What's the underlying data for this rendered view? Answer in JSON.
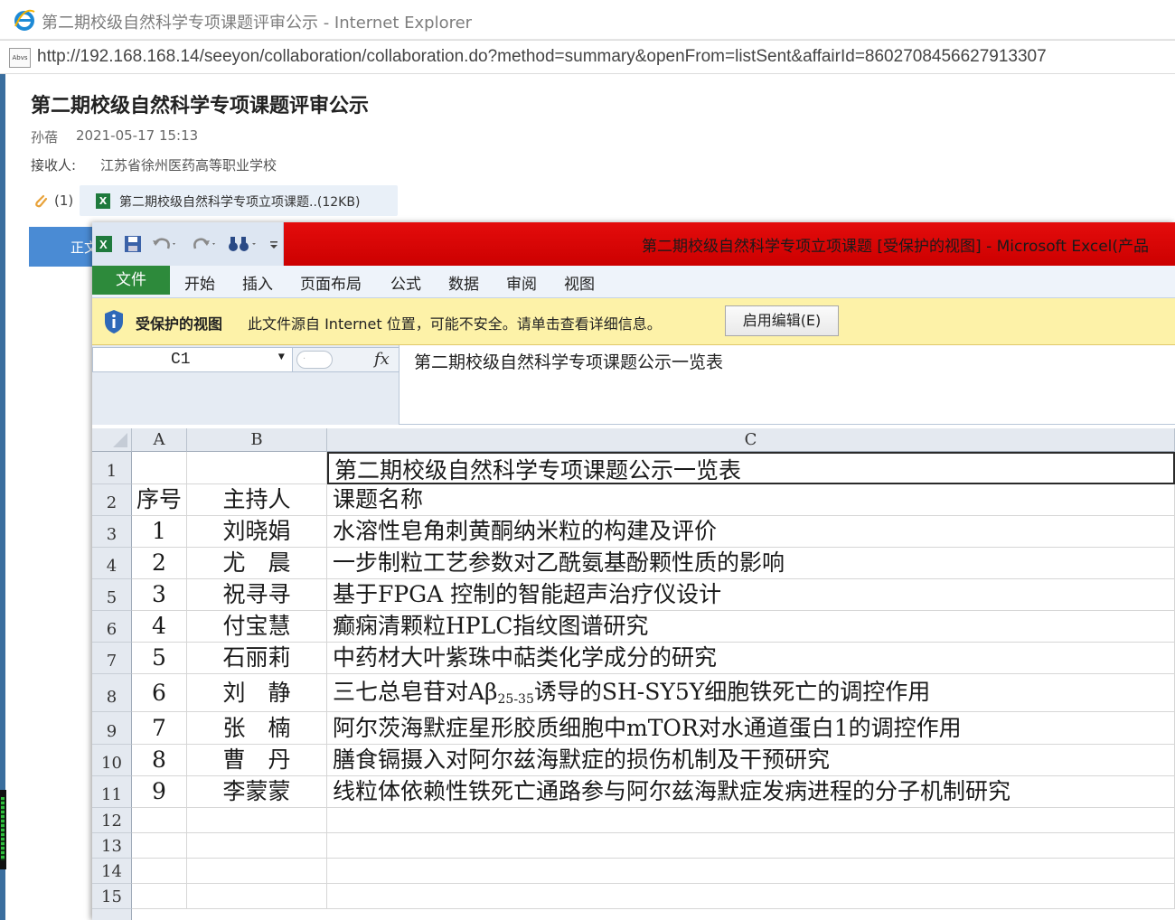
{
  "browser": {
    "window_title": "第二期校级自然科学专项课题评审公示 - Internet Explorer",
    "address_url": "http://192.168.168.14/seeyon/collaboration/collaboration.do?method=summary&openFrom=listSent&affairId=8602708456627913307",
    "page_icon_text": "Abvs"
  },
  "document": {
    "title": "第二期校级自然科学专项课题评审公示",
    "author": "孙蓓",
    "time": "2021-05-17 15:13",
    "receiver_label": "接收人:",
    "receiver": "江苏省徐州医药高等职业学校",
    "attachment_count": "(1)",
    "attachment_name": "第二期校级自然科学专项立项课题..(12KB)",
    "tab_partial_label": "正文"
  },
  "excel": {
    "window_title": "第二期校级自然科学专项立项课题  [受保护的视图]  -  Microsoft Excel(产品",
    "tabs": [
      "文件",
      "开始",
      "插入",
      "页面布局",
      "公式",
      "数据",
      "审阅",
      "视图"
    ],
    "protected_view": {
      "label": "受保护的视图",
      "message": "此文件源自 Internet 位置，可能不安全。请单击查看详细信息。",
      "button": "启用编辑(E)"
    },
    "name_box": "C1",
    "fx_label": "fx",
    "formula": "第二期校级自然科学专项课题公示一览表",
    "columns": [
      "A",
      "B",
      "C"
    ],
    "row_numbers": [
      "1",
      "2",
      "3",
      "4",
      "5",
      "6",
      "7",
      "8",
      "9",
      "10",
      "11",
      "12",
      "13",
      "14",
      "15"
    ],
    "sheet_title": "第二期校级自然科学专项课题公示一览表",
    "headers": {
      "seq": "序号",
      "host": "主持人",
      "name": "课题名称"
    },
    "rows": [
      {
        "seq": "1",
        "host": "刘晓娟",
        "name": "水溶性皂角刺黄酮纳米粒的构建及评价"
      },
      {
        "seq": "2",
        "host": "尤　晨",
        "name": "一步制粒工艺参数对乙酰氨基酚颗性质的影响"
      },
      {
        "seq": "3",
        "host": "祝寻寻",
        "name": "基于FPGA 控制的智能超声治疗仪设计"
      },
      {
        "seq": "4",
        "host": "付宝慧",
        "name": "癫痫清颗粒HPLC指纹图谱研究"
      },
      {
        "seq": "5",
        "host": "石丽莉",
        "name": "中药材大叶紫珠中萜类化学成分的研究"
      },
      {
        "seq": "6",
        "host": "刘　静",
        "name_pre": "三七总皂苷对Aβ",
        "name_sub": "25-35",
        "name_post": "诱导的SH-SY5Y细胞铁死亡的调控作用"
      },
      {
        "seq": "7",
        "host": "张　楠",
        "name": "阿尔茨海默症星形胶质细胞中mTOR对水通道蛋白1的调控作用"
      },
      {
        "seq": "8",
        "host": "曹　丹",
        "name": "膳食镉摄入对阿尔兹海默症的损伤机制及干预研究"
      },
      {
        "seq": "9",
        "host": "李蒙蒙",
        "name": "线粒体依赖性铁死亡通路参与阿尔兹海默症发病进程的分子机制研究"
      }
    ]
  }
}
